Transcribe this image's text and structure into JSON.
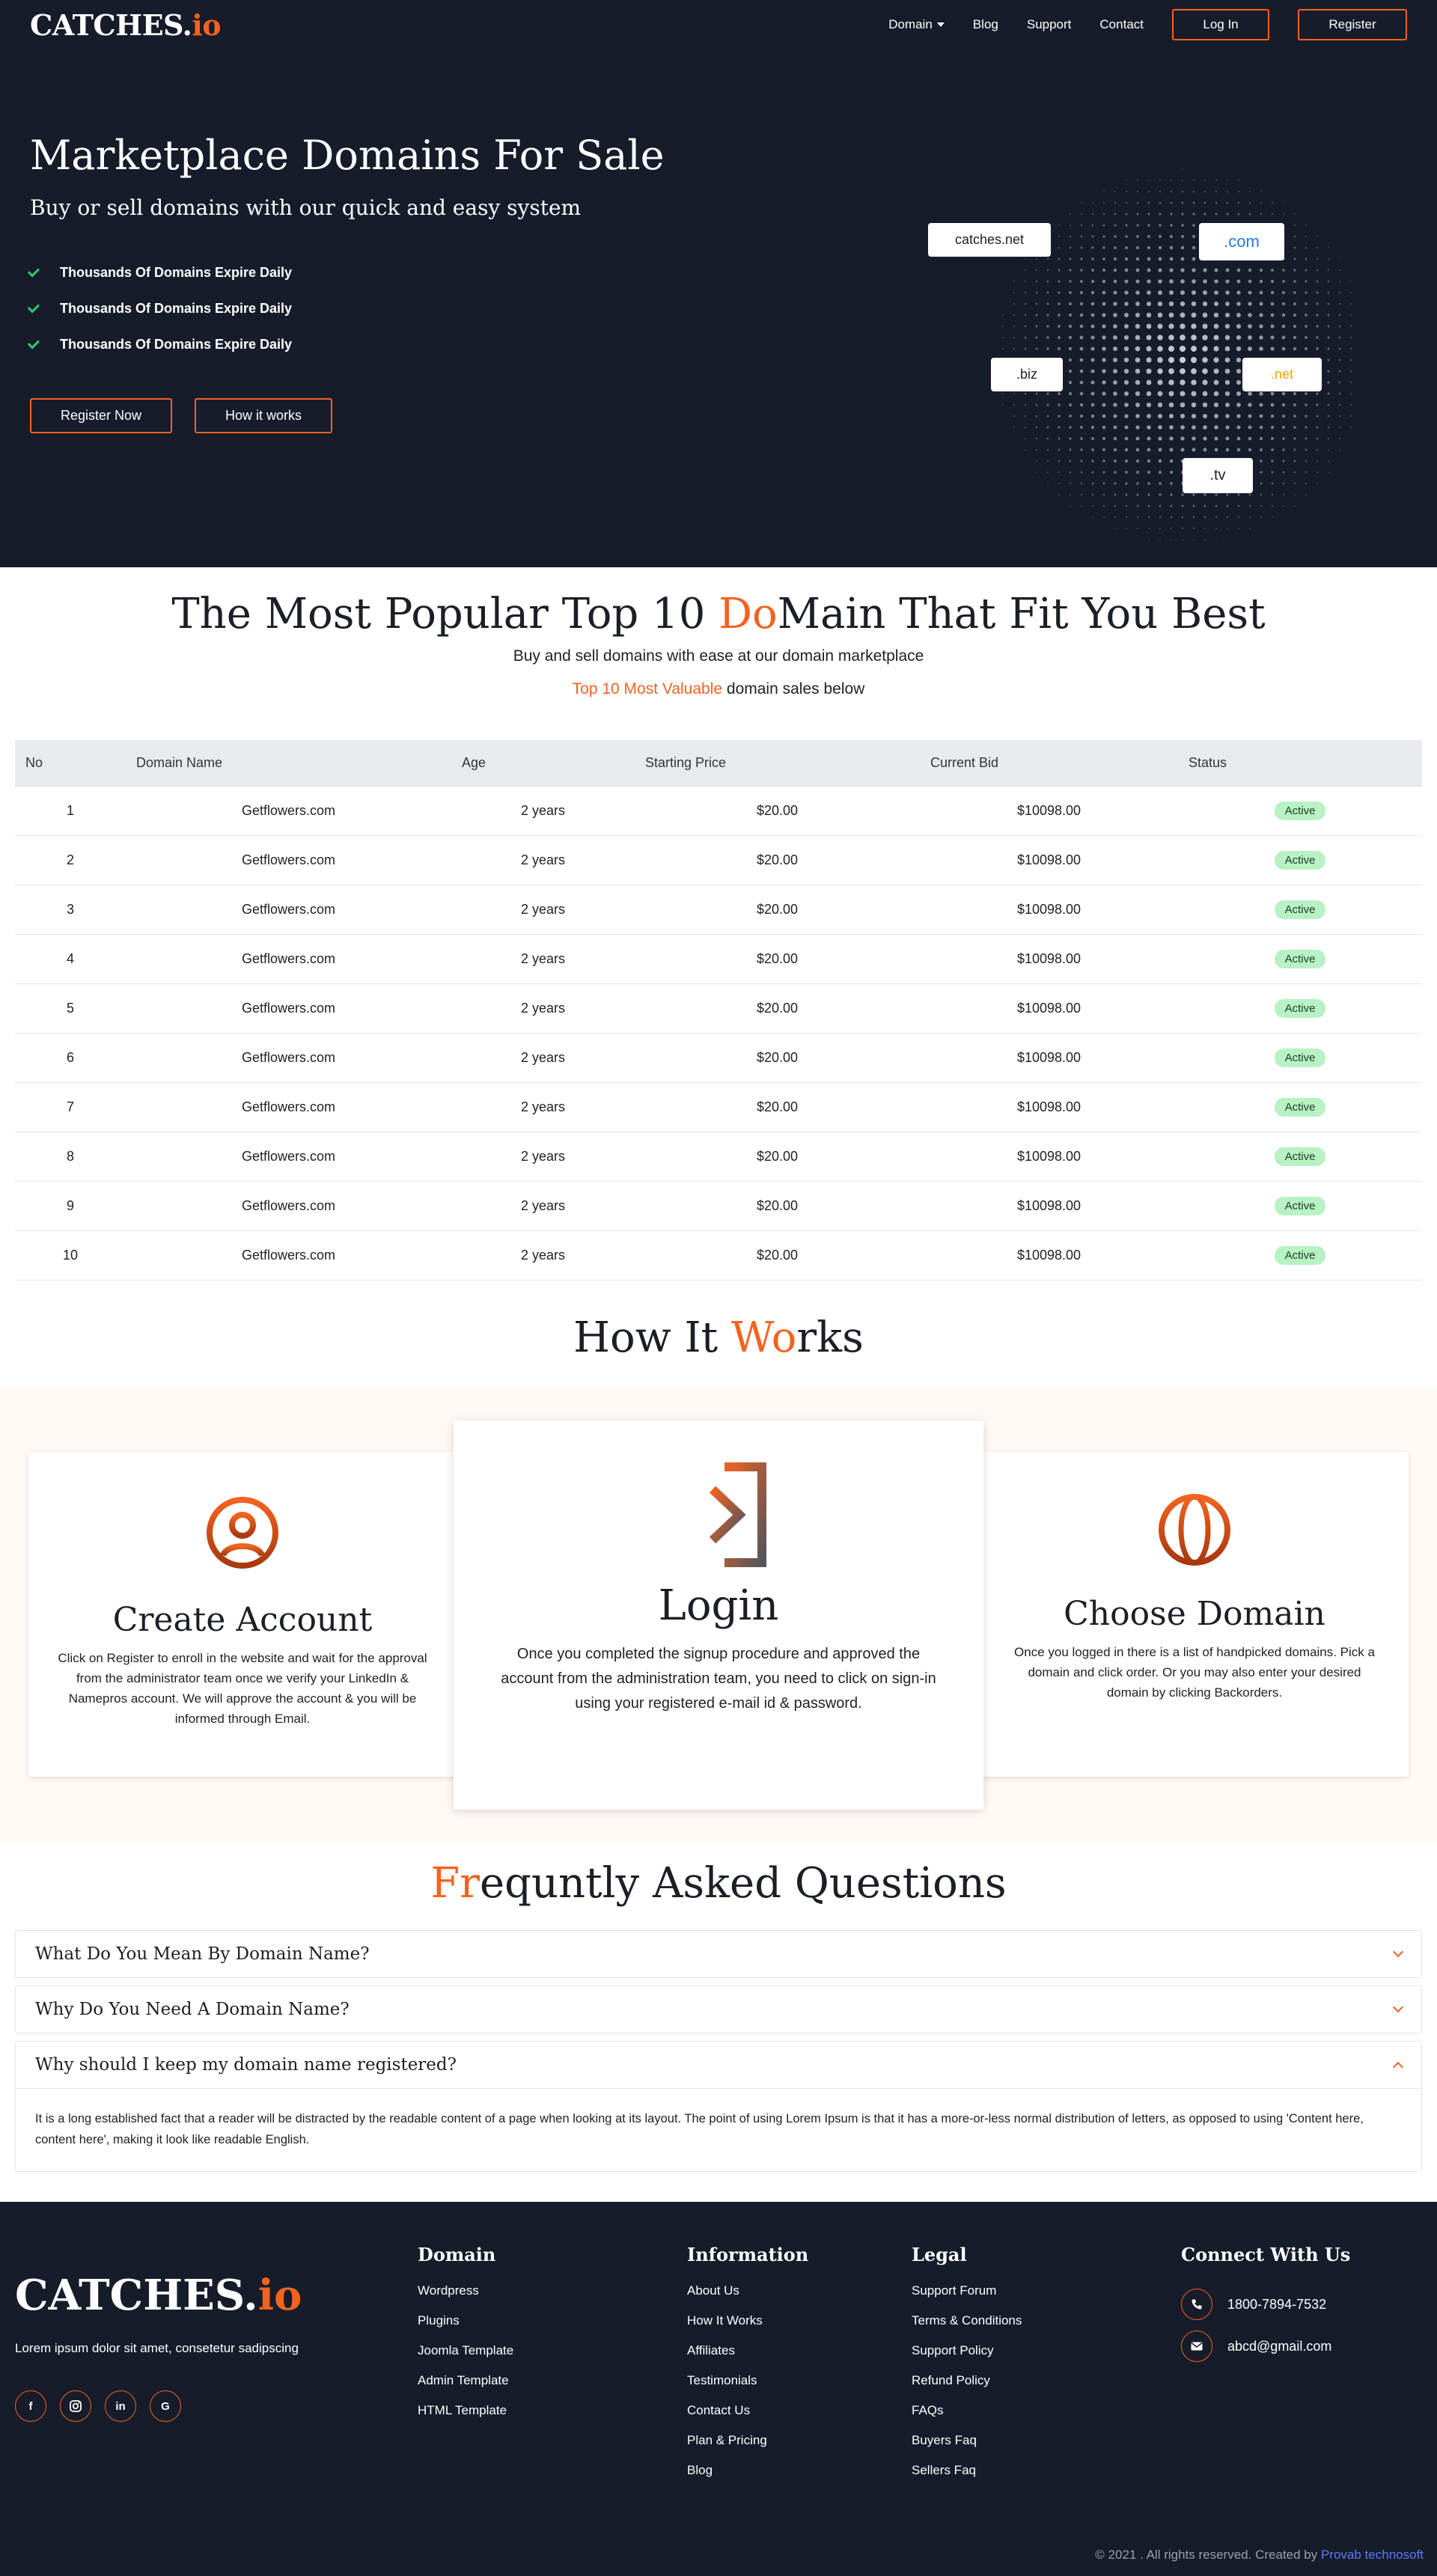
{
  "header": {
    "logo_main": "CATCHES.",
    "logo_tld": "io",
    "nav": {
      "domain": "Domain",
      "blog": "Blog",
      "support": "Support",
      "contact": "Contact"
    },
    "login": "Log In",
    "register": "Register"
  },
  "hero": {
    "title": "Marketplace Domains For Sale",
    "subtitle": "Buy or sell domains with our quick and easy system",
    "features": [
      "Thousands Of Domains Expire Daily",
      "Thousands Of Domains Expire Daily",
      "Thousands Of Domains Expire Daily"
    ],
    "register_now": "Register Now",
    "how_it_works": "How it works",
    "chips": [
      ".com",
      ".biz",
      ".net",
      ".tv"
    ],
    "chip_main": "catches.net"
  },
  "popular": {
    "title_a": "The Most Popular Top 10 ",
    "title_accent": "Do",
    "title_b": "Main That Fit You Best",
    "lead": "Buy and sell domains with ease at our domain marketplace",
    "lead2_accent": "Top 10 Most Valuable",
    "lead2_rest": " domain sales below"
  },
  "table": {
    "headers": [
      "No",
      "Domain Name",
      "Age",
      "Starting Price",
      "Current Bid",
      "Status"
    ],
    "rows": [
      [
        "1",
        "Getflowers.com",
        "2 years",
        "$20.00",
        "$10098.00",
        "Active"
      ],
      [
        "2",
        "Getflowers.com",
        "2 years",
        "$20.00",
        "$10098.00",
        "Active"
      ],
      [
        "3",
        "Getflowers.com",
        "2 years",
        "$20.00",
        "$10098.00",
        "Active"
      ],
      [
        "4",
        "Getflowers.com",
        "2 years",
        "$20.00",
        "$10098.00",
        "Active"
      ],
      [
        "5",
        "Getflowers.com",
        "2 years",
        "$20.00",
        "$10098.00",
        "Active"
      ],
      [
        "6",
        "Getflowers.com",
        "2 years",
        "$20.00",
        "$10098.00",
        "Active"
      ],
      [
        "7",
        "Getflowers.com",
        "2 years",
        "$20.00",
        "$10098.00",
        "Active"
      ],
      [
        "8",
        "Getflowers.com",
        "2 years",
        "$20.00",
        "$10098.00",
        "Active"
      ],
      [
        "9",
        "Getflowers.com",
        "2 years",
        "$20.00",
        "$10098.00",
        "Active"
      ],
      [
        "10",
        "Getflowers.com",
        "2 years",
        "$20.00",
        "$10098.00",
        "Active"
      ]
    ]
  },
  "how": {
    "title_a": "How It ",
    "title_accent": "Wo",
    "title_b": "rks",
    "cards": [
      {
        "icon": "user-circle-icon",
        "title": "Create Account",
        "text": "Click on Register to enroll in the website and wait for the approval from the administrator team once we verify your LinkedIn & Namepros account. We will approve the account & you will be informed through Email."
      },
      {
        "icon": "login-arrow-icon",
        "title": "Login",
        "text": "Once you completed the signup procedure and approved the account from the administration team, you need to click on sign-in using your registered e-mail id & password."
      },
      {
        "icon": "globe-icon",
        "title": "Choose Domain",
        "text": "Once you logged in there is a list of handpicked domains. Pick a domain and click order. Or you may also enter your desired domain by clicking Backorders."
      }
    ]
  },
  "faq": {
    "title_accent": "Fr",
    "title_rest": "equntly Asked Questions",
    "items": [
      {
        "q": "What Do You Mean By Domain Name?"
      },
      {
        "q": "Why Do You Need A Domain Name?"
      },
      {
        "q": "Why should I keep my domain name registered?",
        "a": "It is a long established fact that a reader will be distracted by the readable content of a page when looking at its layout. The point of using Lorem Ipsum is that it has a more-or-less normal distribution of letters, as opposed to using 'Content here, content here', making it look like readable English."
      }
    ]
  },
  "footer": {
    "logo_main": "CATCHES.",
    "logo_tld": "io",
    "desc": "Lorem ipsum dolor sit amet, consetetur sadipscing",
    "socials": [
      "facebook-icon",
      "instagram-icon",
      "linkedin-icon",
      "google-icon"
    ],
    "domain": {
      "title": "Domain",
      "links": [
        "Wordpress",
        "Plugins",
        "Joomla Template",
        "Admin Template",
        "HTML Template"
      ]
    },
    "information": {
      "title": "Information",
      "links": [
        "About Us",
        "How It Works",
        "Affiliates",
        "Testimonials",
        "Contact Us",
        "Plan & Pricing",
        "Blog"
      ]
    },
    "legal": {
      "title": "Legal",
      "links": [
        "Support Forum",
        "Terms & Conditions",
        "Support Policy",
        "Refund Policy",
        "FAQs",
        "Buyers Faq",
        "Sellers Faq"
      ]
    },
    "connect": {
      "title": "Connect With Us",
      "phone": "1800-7894-7532",
      "email": "abcd@gmail.com"
    },
    "copyright": "© 2021 . All rights reserved. Created by ",
    "copyright_link": "Provab technosoft"
  },
  "colors": {
    "accent": "#f26320",
    "dark": "#171c2b",
    "check": "#2ec96a",
    "badge": "#b8f2c4",
    "com": "#1f7ad6",
    "net": "#f5a40b"
  }
}
